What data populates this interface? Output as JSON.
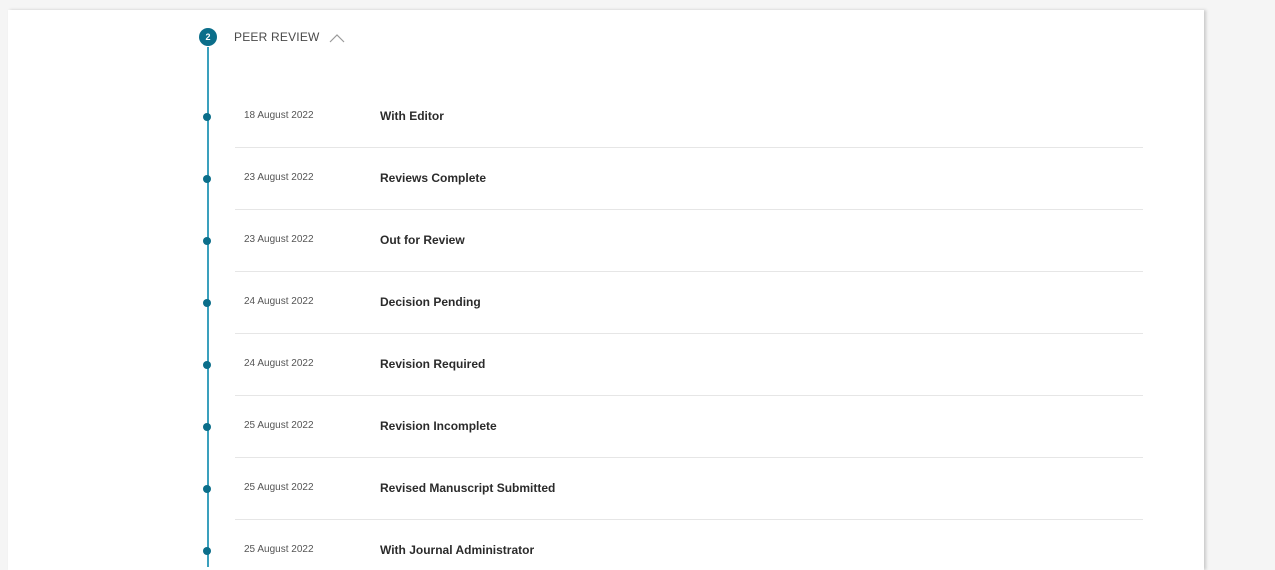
{
  "section": {
    "step_number": "2",
    "title": "PEER REVIEW",
    "expanded": true,
    "accent_color": "#0b6e8a",
    "line_color": "#3aa0bd"
  },
  "timeline": [
    {
      "date": "18 August 2022",
      "status": "With Editor"
    },
    {
      "date": "23 August 2022",
      "status": "Reviews Complete"
    },
    {
      "date": "23 August 2022",
      "status": "Out for Review"
    },
    {
      "date": "24 August 2022",
      "status": "Decision Pending"
    },
    {
      "date": "24 August 2022",
      "status": "Revision Required"
    },
    {
      "date": "25 August 2022",
      "status": "Revision Incomplete"
    },
    {
      "date": "25 August 2022",
      "status": "Revised Manuscript Submitted"
    },
    {
      "date": "25 August 2022",
      "status": "With Journal Administrator"
    }
  ]
}
